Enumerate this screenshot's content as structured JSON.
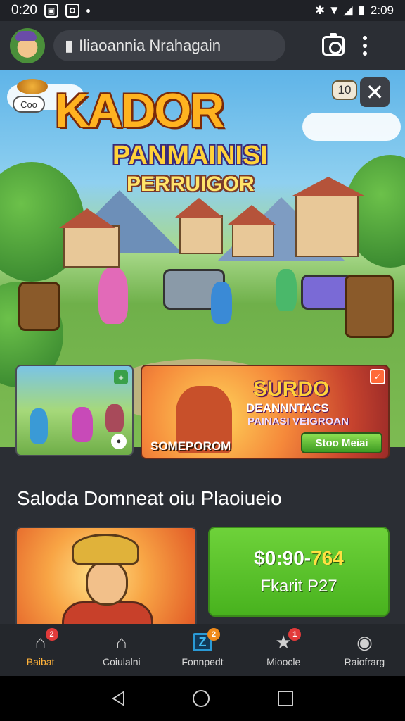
{
  "status_bar": {
    "time": "0:20",
    "right_text": "2:09"
  },
  "header": {
    "search_text": "Iliaoannia Nrahagain",
    "icons": [
      "avatar",
      "camera-icon",
      "more-vert-icon"
    ]
  },
  "hero": {
    "title": "KADOR",
    "subtitle_1": "PANMAINISI",
    "subtitle_2": "PERRUIGOR",
    "coin_badge": "Coo",
    "level_badge": "10",
    "close_label": "✕"
  },
  "thumbnails": {
    "left_badge": "+",
    "promo": {
      "title": "SURDO",
      "subtitle": "DEANNNTACS",
      "subtitle_2": "PAINASI VEIGROAN",
      "label": "SOMEPOROM",
      "button": "Stoo Meiai"
    }
  },
  "section": {
    "title": "Saloda Domneat oiu Plaoiueio"
  },
  "product": {
    "price_prefix": "$0:90-",
    "price_accent": "764",
    "price_label": "Fkarit P27"
  },
  "bottom_nav": {
    "items": [
      {
        "label": "Baibat",
        "icon": "home-icon",
        "badge": "2",
        "active": true
      },
      {
        "label": "Coiulalni",
        "icon": "store-icon",
        "badge": "",
        "active": false
      },
      {
        "label": "Fonnpedt",
        "icon": "z-app-icon",
        "badge": "2",
        "active": false
      },
      {
        "label": "Mioocle",
        "icon": "star-icon",
        "badge": "1",
        "active": false
      },
      {
        "label": "Raiofrarg",
        "icon": "profile-icon",
        "badge": "",
        "active": false
      }
    ]
  },
  "colors": {
    "accent": "#ffb23a",
    "price_green": "#5ec42c",
    "background": "#2b2e34"
  }
}
